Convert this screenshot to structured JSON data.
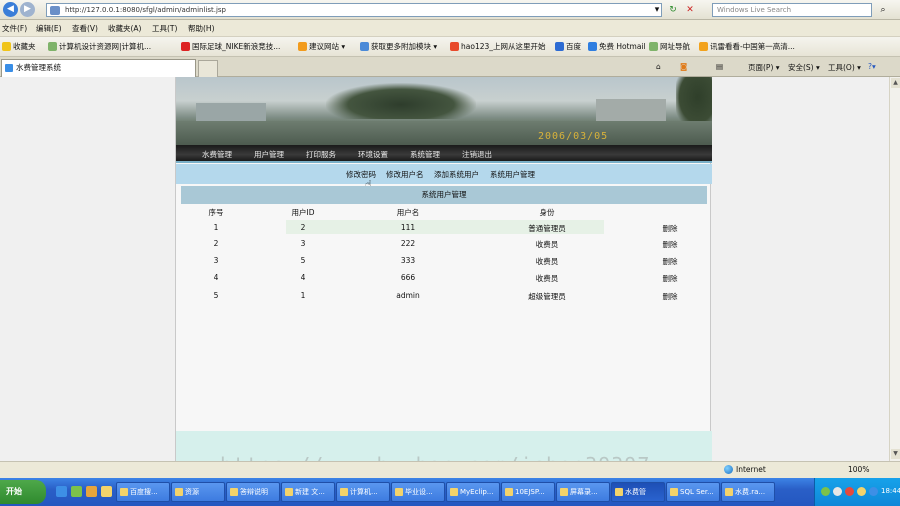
{
  "browser": {
    "address": "http://127.0.0.1:8080/sfgl/admin/adminlist.jsp",
    "search_placeholder": "Windows Live Search",
    "menu": [
      "文件(F)",
      "编辑(E)",
      "查看(V)",
      "收藏夹(A)",
      "工具(T)",
      "帮助(H)"
    ],
    "favorites_label": "收藏夹",
    "favorites": [
      "计算机设计资源网|计算机...",
      "国际足球_NIKE新浪竞技...",
      "建议网站 ▾",
      "获取更多附加模块 ▾",
      "hao123_上网从这里开始",
      "百度",
      "免费 Hotmail",
      "网址导航",
      "讯雷看看-中国第一高清..."
    ],
    "tab_title": "水费管理系统",
    "commands": [
      "页面(P) ▾",
      "安全(S) ▾",
      "工具(O) ▾"
    ],
    "status_zone": "Internet",
    "zoom": "100%"
  },
  "site": {
    "banner_date": "2006/03/05",
    "nav": [
      "水费管理",
      "用户管理",
      "打印服务",
      "环境设置",
      "系统管理",
      "注销退出"
    ],
    "subnav": [
      "修改密码",
      "修改用户名",
      "添加系统用户",
      "系统用户管理"
    ],
    "table_title": "系统用户管理",
    "columns": [
      "序号",
      "用户ID",
      "用户名",
      "身份",
      ""
    ],
    "rows": [
      {
        "seq": "1",
        "uid": "2",
        "name": "111",
        "role": "普通管理员",
        "action": "删除"
      },
      {
        "seq": "2",
        "uid": "3",
        "name": "222",
        "role": "收费员",
        "action": "删除"
      },
      {
        "seq": "3",
        "uid": "5",
        "name": "333",
        "role": "收费员",
        "action": "删除"
      },
      {
        "seq": "4",
        "uid": "4",
        "name": "666",
        "role": "收费员",
        "action": "删除"
      },
      {
        "seq": "5",
        "uid": "1",
        "name": "admin",
        "role": "超级管理员",
        "action": "删除"
      }
    ]
  },
  "taskbar": {
    "start": "开始",
    "tasks": [
      "百度搜...",
      "资源",
      "答辩说明",
      "新建 文...",
      "计算机...",
      "毕业设...",
      "MyEclip...",
      "10EJSP...",
      "屏幕录...",
      "水费管",
      "SQL Ser...",
      "水费.ra..."
    ],
    "clock": "18:44"
  },
  "watermark": "https://www.huzhan.com/ishop39397"
}
